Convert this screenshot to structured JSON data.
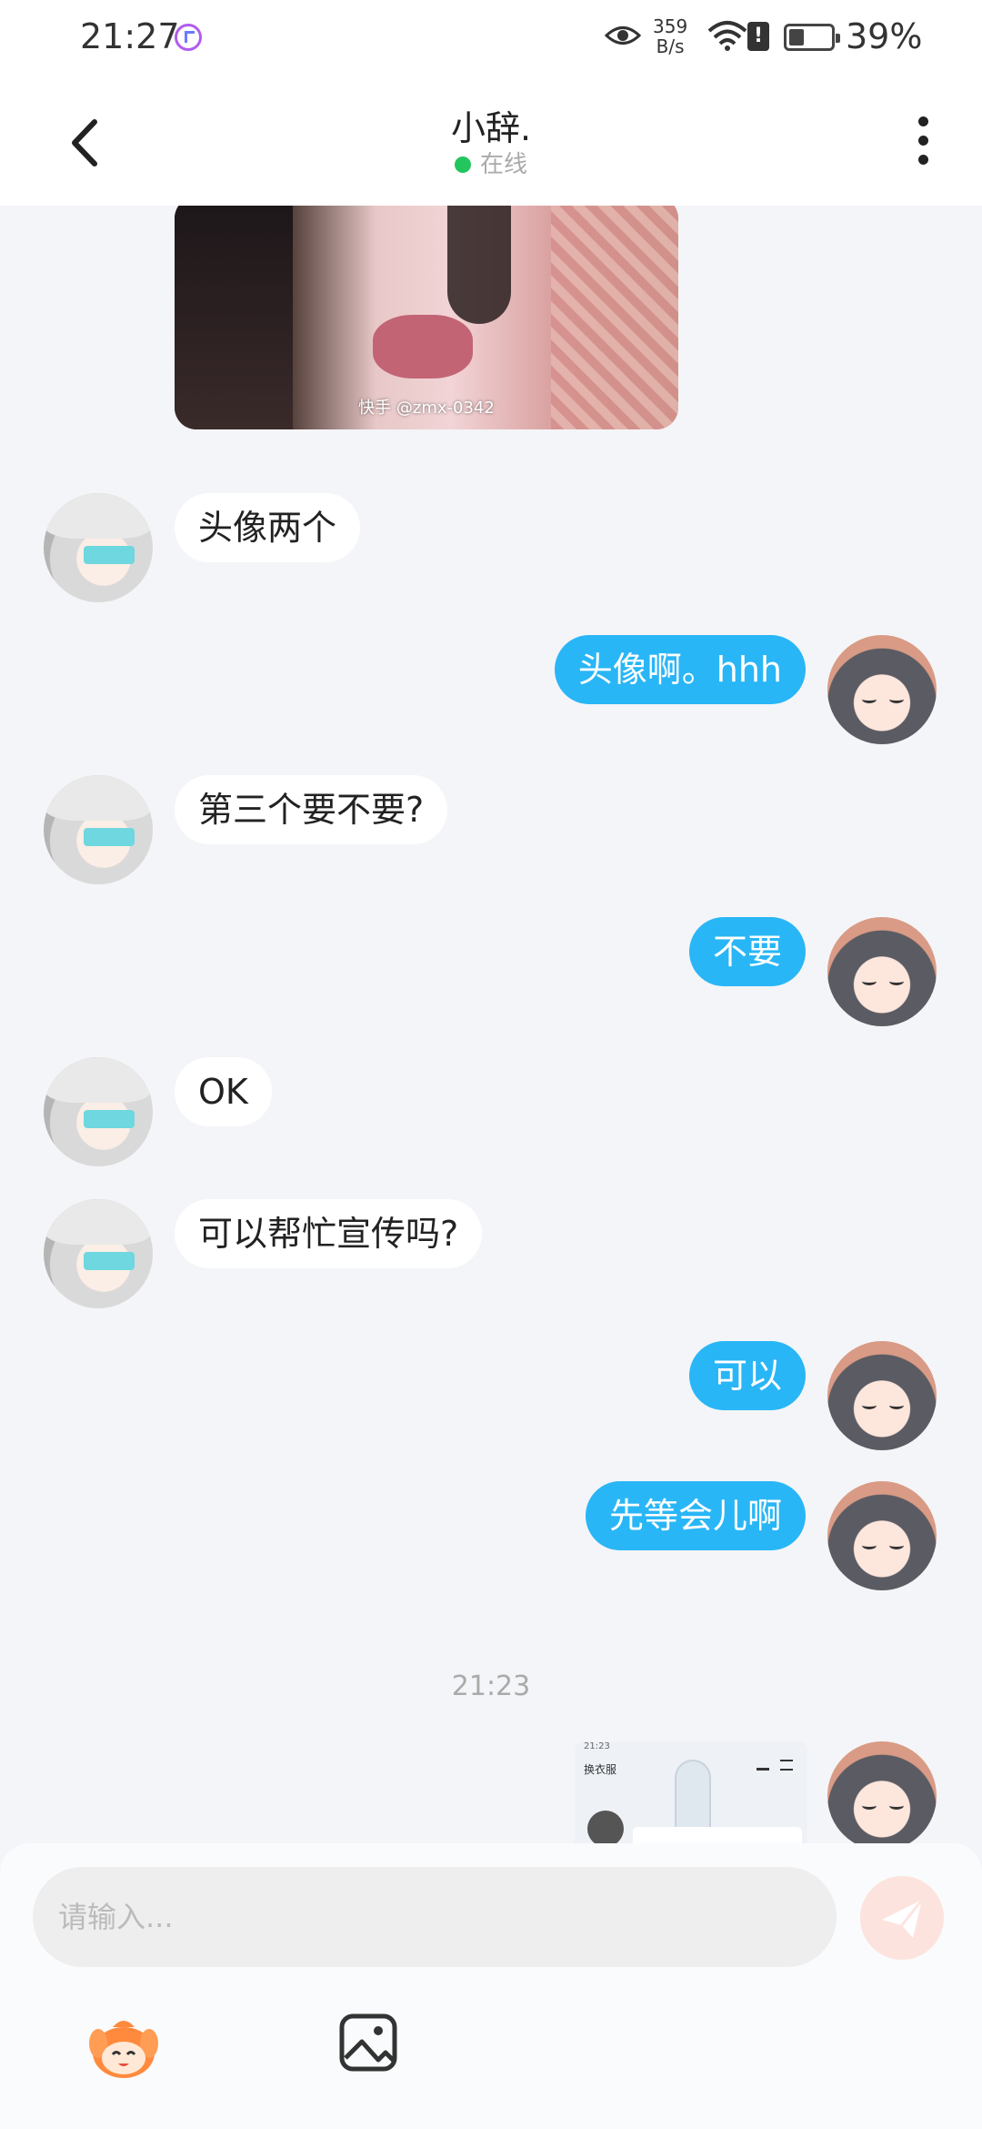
{
  "status_bar": {
    "time": "21:27",
    "net_speed_value": "359",
    "net_speed_unit": "B/s",
    "battery_percent": "39%"
  },
  "header": {
    "title": "小辞.",
    "status_text": "在线",
    "online_color": "#22c55e"
  },
  "colors": {
    "outgoing_bubble": "#29b6f6",
    "incoming_bubble": "#ffffff",
    "background": "#f4f5f8",
    "send_button": "#fde3de"
  },
  "chat": {
    "photo_watermark": "快手 @zmx-0342",
    "messages": [
      {
        "side": "left",
        "text": "头像两个"
      },
      {
        "side": "right",
        "text": "头像啊。hhh"
      },
      {
        "side": "left",
        "text": "第三个要不要?"
      },
      {
        "side": "right",
        "text": "不要"
      },
      {
        "side": "left",
        "text": "OK"
      },
      {
        "side": "left",
        "text": "可以帮忙宣传吗?"
      },
      {
        "side": "right",
        "text": "可以"
      },
      {
        "side": "right",
        "text": "先等会儿啊"
      }
    ],
    "time_separator": "21:23",
    "screenshot_preview": {
      "status_text": "21:23",
      "title": "换衣服"
    }
  },
  "composer": {
    "placeholder": "请输入..."
  },
  "icons": {
    "back": "back-arrow-icon",
    "more": "more-vertical-icon",
    "send": "paper-plane-icon",
    "emoji": "emoji-mascot-icon",
    "image": "image-icon"
  }
}
